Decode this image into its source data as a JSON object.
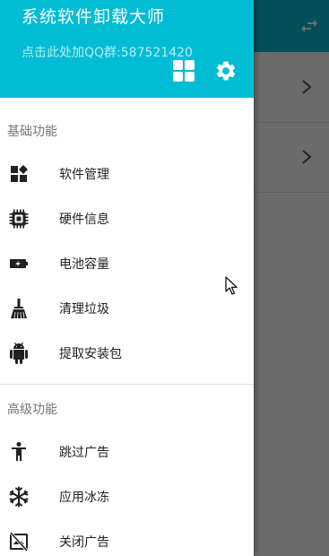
{
  "app": {
    "title": "系统软件卸载大师",
    "qq_text": "点击此处加QQ群:587521420"
  },
  "header_icons": {
    "grid": "grid-icon",
    "settings": "gear-icon"
  },
  "background": {
    "toolbar_icon": "swap-icon",
    "row_icon": "chevron-right-icon"
  },
  "sections": {
    "basic": "基础功能",
    "advanced": "高级功能"
  },
  "basic_items": [
    {
      "label": "软件管理",
      "icon": "apps-icon"
    },
    {
      "label": "硬件信息",
      "icon": "chip-icon"
    },
    {
      "label": "电池容量",
      "icon": "battery-charging-icon"
    },
    {
      "label": "清理垃圾",
      "icon": "broom-icon"
    },
    {
      "label": "提取安装包",
      "icon": "android-icon"
    }
  ],
  "advanced_items": [
    {
      "label": "跳过广告",
      "icon": "person-icon"
    },
    {
      "label": "应用冰冻",
      "icon": "snowflake-icon"
    },
    {
      "label": "关闭广告",
      "icon": "ad-off-icon"
    }
  ],
  "colors": {
    "primary": "#00bcd4",
    "scrim": "#6b6b6b",
    "text": "#212121",
    "section_text": "#757575"
  }
}
